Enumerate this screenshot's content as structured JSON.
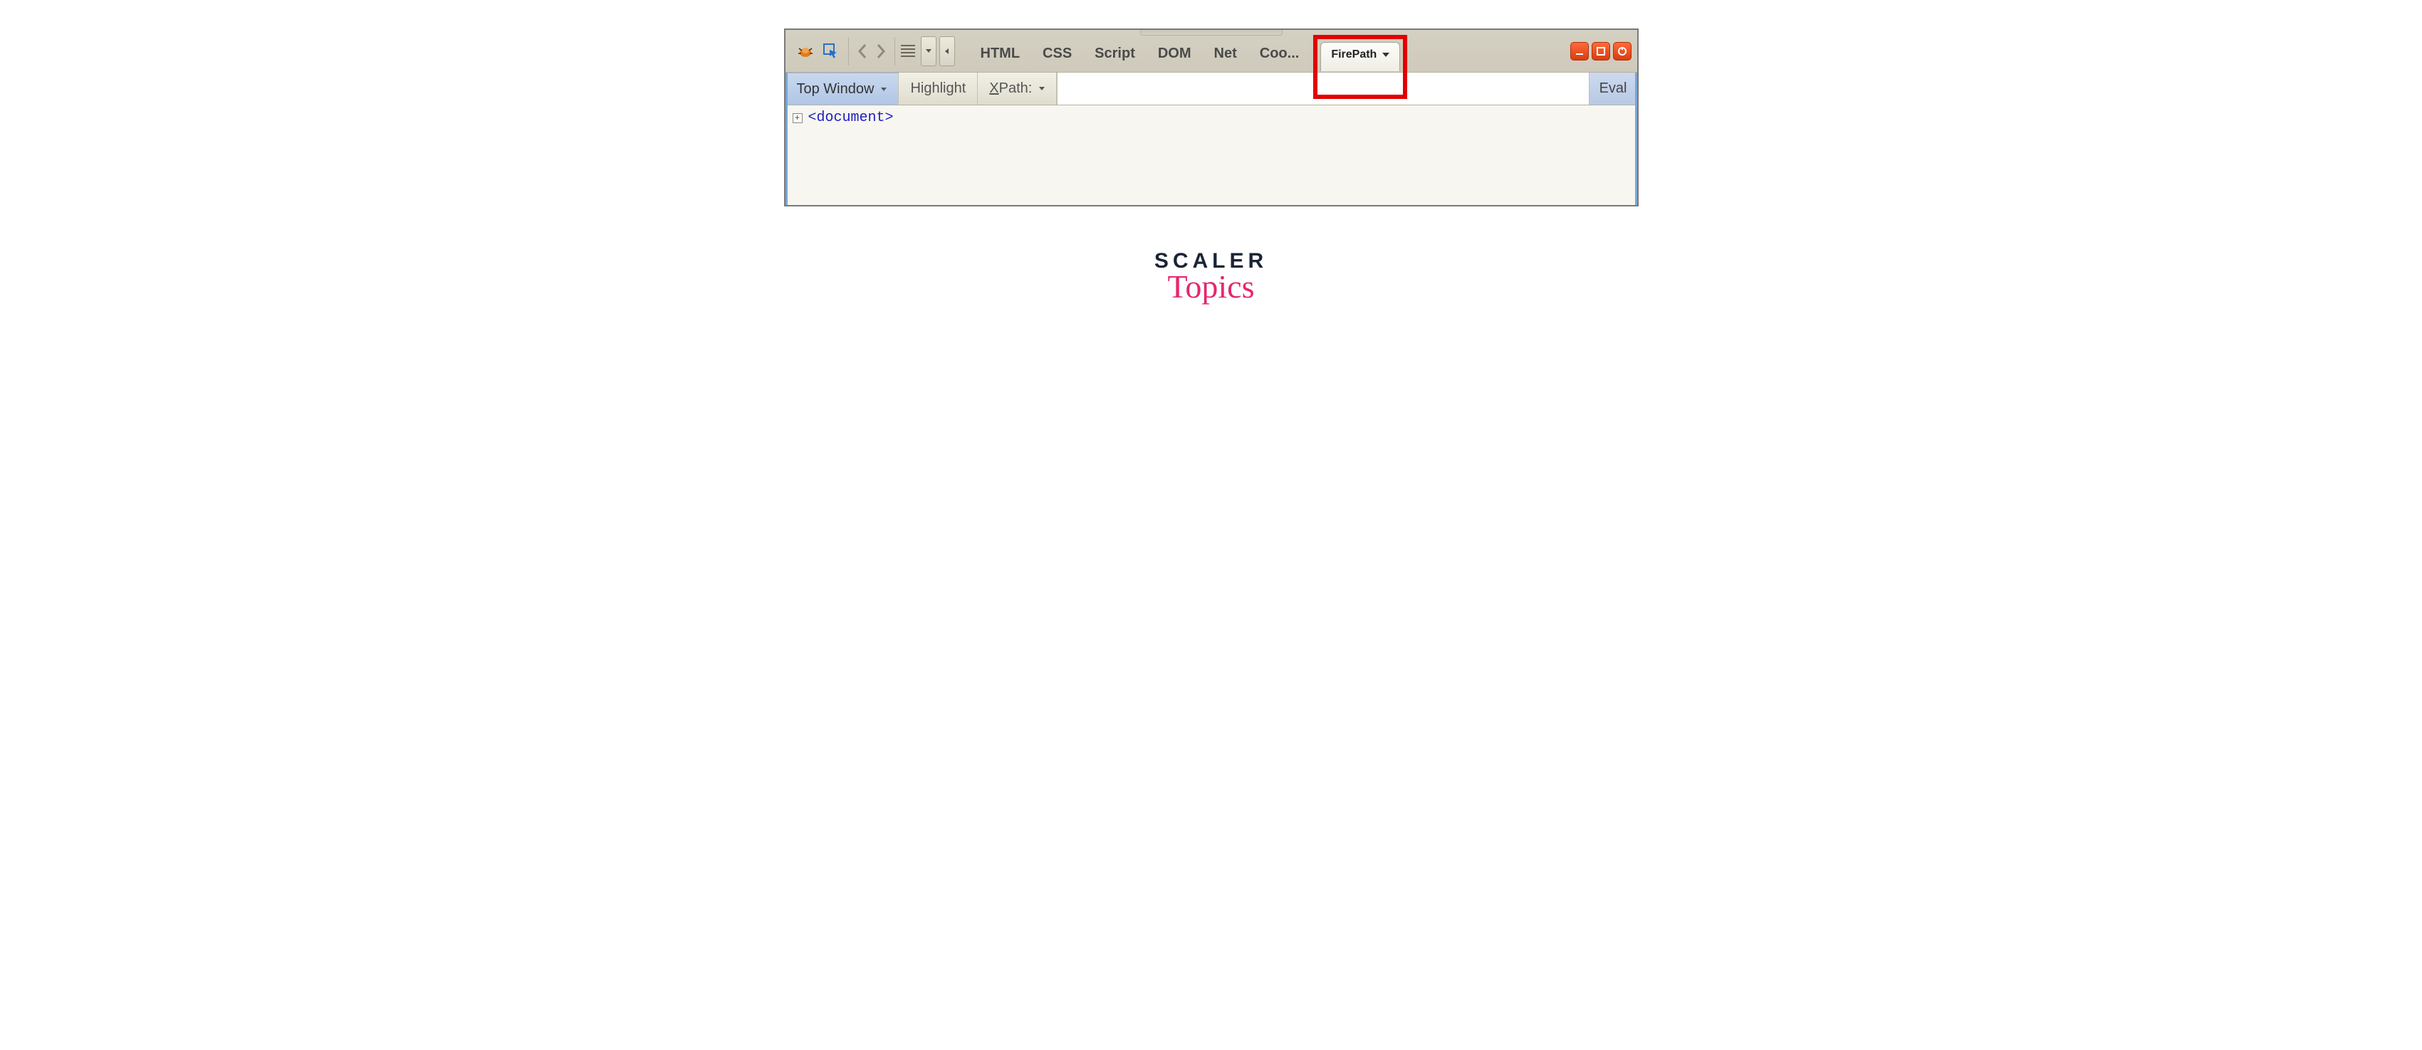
{
  "toolbar": {
    "tabs": [
      "HTML",
      "CSS",
      "Script",
      "DOM",
      "Net",
      "Coo..."
    ],
    "active_tab": "FirePath"
  },
  "sub_toolbar": {
    "top_window": "Top Window",
    "highlight": "Highlight",
    "xpath_label_prefix": "X",
    "xpath_label_suffix": "Path:",
    "eval": "Eval"
  },
  "content": {
    "expand_symbol": "+",
    "node_open": "<",
    "node_name": "document",
    "node_close": ">"
  },
  "logo": {
    "line1": "SCALER",
    "line2": "Topics"
  }
}
